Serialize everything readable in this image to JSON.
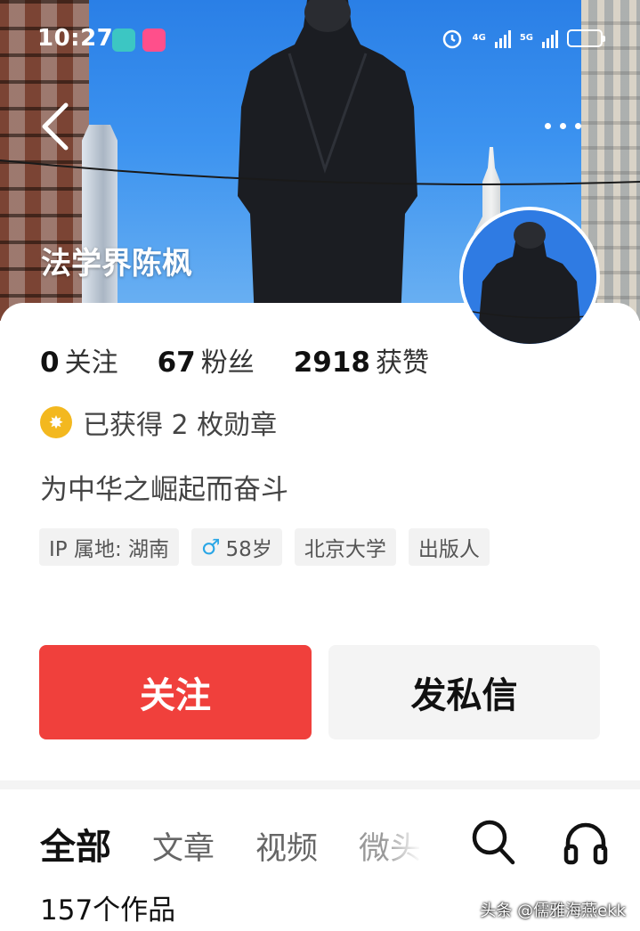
{
  "status_bar": {
    "time": "10:27",
    "network_1": "4G",
    "network_2": "5G"
  },
  "header": {
    "back_icon": "chevron-left-icon",
    "more_icon": "more-dots-icon",
    "profile_name": "法学界陈枫"
  },
  "stats": [
    {
      "value": "0",
      "label": "关注"
    },
    {
      "value": "67",
      "label": "粉丝"
    },
    {
      "value": "2918",
      "label": "获赞"
    }
  ],
  "medal": {
    "text": "已获得 2 枚勋章",
    "icon": "medal-icon"
  },
  "bio": "为中华之崛起而奋斗",
  "tags": {
    "ip": "IP 属地: 湖南",
    "age": "58岁",
    "school": "北京大学",
    "occupation": "出版人"
  },
  "actions": {
    "follow_label": "关注",
    "message_label": "发私信"
  },
  "tabs": [
    {
      "label": "全部",
      "active": true
    },
    {
      "label": "文章",
      "active": false
    },
    {
      "label": "视频",
      "active": false
    },
    {
      "label": "微头",
      "active": false
    }
  ],
  "works_count": "157个作品",
  "watermark": "头条 @儒雅海燕ekk",
  "colors": {
    "follow_red": "#f0403c",
    "medal_gold": "#f3b81f",
    "gender_blue": "#29a6e6",
    "sky_blue": "#2a7fe6"
  }
}
